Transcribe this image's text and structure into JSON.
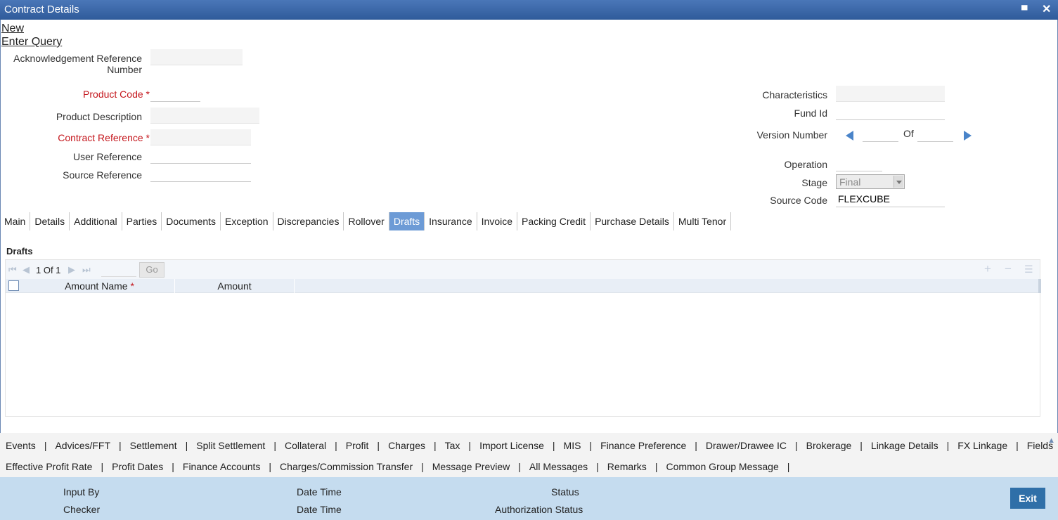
{
  "window": {
    "title": "Contract Details",
    "minimize_symbol": "▄",
    "close_symbol": "✕"
  },
  "actions": {
    "new": "New",
    "enter_query": "Enter Query"
  },
  "form": {
    "ack_ref_label_line1": "Acknowledgement Reference",
    "ack_ref_label_line2": "Number",
    "product_code_label": "Product Code",
    "product_description_label": "Product Description",
    "contract_reference_label": "Contract Reference",
    "user_reference_label": "User Reference",
    "source_reference_label": "Source Reference",
    "required_mark": "*",
    "characteristics_label": "Characteristics",
    "fund_id_label": "Fund Id",
    "version_number_label": "Version Number",
    "of_label": "Of",
    "operation_label": "Operation",
    "stage_label": "Stage",
    "stage_value": "Final",
    "source_code_label": "Source Code",
    "source_code_value": "FLEXCUBE"
  },
  "tabs": [
    {
      "label": "Main"
    },
    {
      "label": "Details"
    },
    {
      "label": "Additional"
    },
    {
      "label": "Parties"
    },
    {
      "label": "Documents"
    },
    {
      "label": "Exception"
    },
    {
      "label": "Discrepancies"
    },
    {
      "label": "Rollover"
    },
    {
      "label": "Drafts"
    },
    {
      "label": "Insurance"
    },
    {
      "label": "Invoice"
    },
    {
      "label": "Packing Credit"
    },
    {
      "label": "Purchase Details"
    },
    {
      "label": "Multi Tenor"
    }
  ],
  "active_tab": "Drafts",
  "drafts": {
    "section_title": "Drafts",
    "pager_text": "1 Of 1",
    "go_label": "Go",
    "columns": [
      "Amount Name",
      "Amount"
    ],
    "required_mark": "*"
  },
  "bottom_links_row1": [
    "Events",
    "Advices/FFT",
    "Settlement",
    "Split Settlement",
    "Collateral",
    "Profit",
    "Charges",
    "Tax",
    "Import License",
    "MIS",
    "Finance Preference",
    "Drawer/Drawee IC",
    "Brokerage",
    "Linkage Details",
    "FX Linkage",
    "Fields"
  ],
  "bottom_links_row2": [
    "Effective Profit Rate",
    "Profit Dates",
    "Finance Accounts",
    "Charges/Commission Transfer",
    "Message Preview",
    "All Messages",
    "Remarks",
    "Common Group Message"
  ],
  "footer": {
    "input_by": "Input By",
    "checker": "Checker",
    "date_time_1": "Date Time",
    "date_time_2": "Date Time",
    "status": "Status",
    "authorization_status": "Authorization Status",
    "exit_label": "Exit"
  }
}
